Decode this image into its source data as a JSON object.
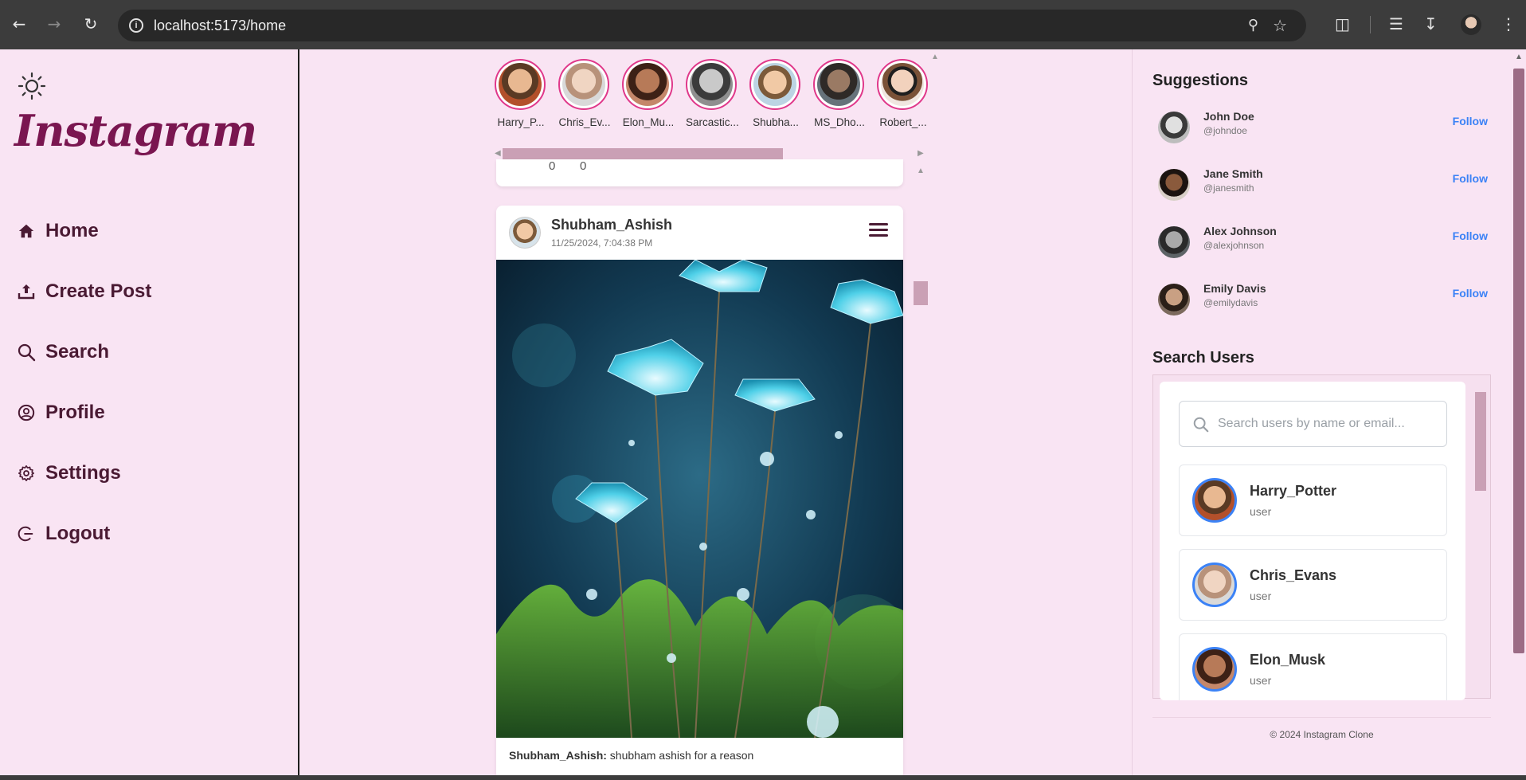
{
  "browser": {
    "url": "localhost:5173/home",
    "back_icon": "arrow-left-icon",
    "forward_icon": "arrow-right-icon",
    "reload_icon": "reload-icon"
  },
  "sidebar": {
    "logo": "Instagram",
    "theme_icon": "sun-icon",
    "items": [
      {
        "label": "Home",
        "icon": "home-icon"
      },
      {
        "label": "Create Post",
        "icon": "upload-icon"
      },
      {
        "label": "Search",
        "icon": "search-icon"
      },
      {
        "label": "Profile",
        "icon": "user-circle-icon"
      },
      {
        "label": "Settings",
        "icon": "gear-icon"
      },
      {
        "label": "Logout",
        "icon": "logout-icon"
      }
    ]
  },
  "stories": [
    {
      "name": "Harry_P...",
      "color": "#b3502b"
    },
    {
      "name": "Chris_Ev...",
      "color": "#c9a58f"
    },
    {
      "name": "Elon_Mu...",
      "color": "#7b4a33"
    },
    {
      "name": "Sarcastic...",
      "color": "#3b3b3b"
    },
    {
      "name": "Shubha...",
      "color": "#d8b48f"
    },
    {
      "name": "MS_Dho...",
      "color": "#4d5559"
    },
    {
      "name": "Robert_...",
      "color": "#c79f80"
    }
  ],
  "previous_post": {
    "likes": "0",
    "comments": "0"
  },
  "post": {
    "username": "Shubham_Ashish",
    "timestamp": "11/25/2024, 7:04:38 PM",
    "caption_user": "Shubham_Ashish:",
    "caption_text": " shubham ashish for a reason"
  },
  "suggestions": {
    "title": "Suggestions",
    "follow_label": "Follow",
    "users": [
      {
        "name": "John Doe",
        "handle": "@johndoe"
      },
      {
        "name": "Jane Smith",
        "handle": "@janesmith"
      },
      {
        "name": "Alex Johnson",
        "handle": "@alexjohnson"
      },
      {
        "name": "Emily Davis",
        "handle": "@emilydavis"
      }
    ]
  },
  "search_users": {
    "title": "Search Users",
    "placeholder": "Search users by name or email...",
    "results": [
      {
        "name": "Harry_Potter",
        "role": "user"
      },
      {
        "name": "Chris_Evans",
        "role": "user"
      },
      {
        "name": "Elon_Musk",
        "role": "user"
      }
    ]
  },
  "footer": "© 2024 Instagram Clone",
  "colors": {
    "background": "#f9e4f3",
    "accent": "#7a1650",
    "follow": "#3b82f6",
    "story_ring": "#e0388a"
  }
}
